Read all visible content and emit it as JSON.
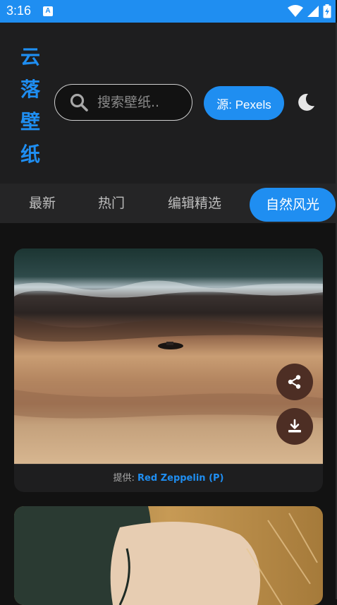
{
  "status_bar": {
    "time": "3:16",
    "notification_badge": "A",
    "icons": [
      "wifi-icon",
      "signal-icon",
      "battery-charging-icon"
    ]
  },
  "app": {
    "title_chars": [
      "云",
      "落",
      "壁",
      "纸"
    ],
    "search_placeholder": "搜索壁纸..",
    "source_label": "源: Pexels",
    "theme_icon": "moon-icon",
    "accent_color": "#1f8ef1"
  },
  "tabs": [
    {
      "label": "最新",
      "active": false
    },
    {
      "label": "热门",
      "active": false
    },
    {
      "label": "编辑精选",
      "active": false
    },
    {
      "label": "自然风光",
      "active": true
    }
  ],
  "cards": [
    {
      "credit_prefix": "提供:",
      "credit_author": "Red Zeppelin (P)",
      "actions": [
        "share-icon",
        "download-icon"
      ]
    },
    {
      "credit_prefix": "",
      "credit_author": ""
    }
  ]
}
